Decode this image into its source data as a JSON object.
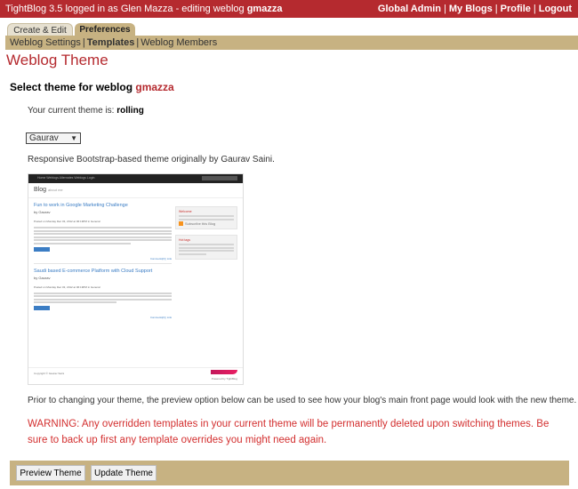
{
  "topbar": {
    "status_prefix": "TightBlog 3.5 logged in as Glen Mazza - editing weblog",
    "weblog_name": "gmazza",
    "links": [
      "Global Admin",
      "My Blogs",
      "Profile",
      "Logout"
    ],
    "separator": "|"
  },
  "tabs": {
    "create_edit": "Create & Edit",
    "preferences": "Preferences"
  },
  "subnav": {
    "items": [
      "Weblog Settings",
      "Templates",
      "Weblog Members"
    ],
    "active": "Templates",
    "separator": "|"
  },
  "page_title": "Weblog Theme",
  "select_section": {
    "label": "Select theme for weblog",
    "weblog_name": "gmazza"
  },
  "current_theme": {
    "label": "Your current theme is:",
    "value": "rolling"
  },
  "theme_select": {
    "selected": "Gaurav",
    "arrow": "▼"
  },
  "theme_description": "Responsive Bootstrap-based theme originally by Gaurav Saini.",
  "preview_image": {
    "nav_links": "Home   Weblogs   Alternates   Weblogs   Login",
    "blog_title": "Blog",
    "blog_subtitle": "about me",
    "posts": [
      {
        "title": "Fun to work in Google Marketing Challenge",
        "author": "by Gaurav",
        "meta": "Posted on Monday Dec 03, 2012 at 06:19PM in General",
        "read_more": "Read More",
        "footer": "Comments[0] | Link"
      },
      {
        "title": "Saudi based E-commerce Platform with Cloud Support",
        "author": "by Gaurav",
        "meta": "Posted on Monday Dec 03, 2012 at 06:19PM in General",
        "read_more": "Read More",
        "footer": "Comments[0] | Link"
      }
    ],
    "sidebar": {
      "welcome_title": "Welcome",
      "rss_label": "Subscribe this Blog",
      "about_title": "Hot tags"
    },
    "copyright": "Copyright © Gaurav Saini",
    "powered": "Powered by TightBlog"
  },
  "preview_note": "Prior to changing your theme, the preview option below can be used to see how your blog's main front page would look with the new theme.",
  "warning": {
    "label": "WARNING",
    "text": ": Any overridden templates in your current theme will be permanently deleted upon switching themes. Be sure to back up first any template overrides you might need again."
  },
  "buttons": {
    "preview": "Preview Theme",
    "update": "Update Theme"
  },
  "colors": {
    "accent_red": "#b52a2f",
    "tan": "#c7b282",
    "warning_red": "#d32f2f"
  }
}
